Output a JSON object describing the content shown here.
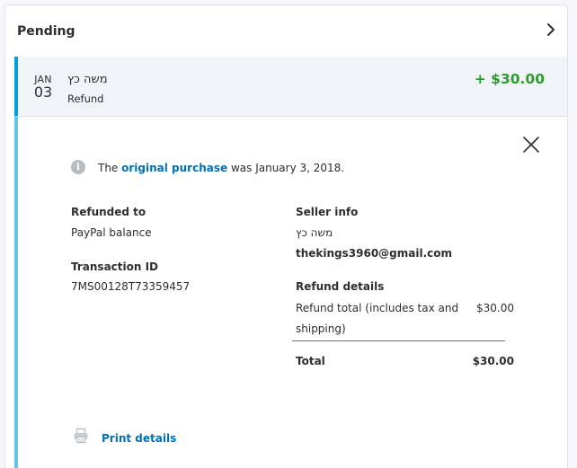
{
  "header": {
    "title": "Pending"
  },
  "transaction": {
    "month": "JAN",
    "day": "03",
    "name": "משה כץ",
    "type": "Refund",
    "amount": "+ $30.00"
  },
  "info": {
    "prefix": "The ",
    "link_text": "original purchase",
    "suffix": " was January 3, 2018."
  },
  "refunded_to": {
    "label": "Refunded to",
    "value": "PayPal balance"
  },
  "transaction_id": {
    "label": "Transaction ID",
    "value": "7MS00128T73359457"
  },
  "seller_info": {
    "label": "Seller info",
    "name": "משה כץ",
    "email": "thekings3960@gmail.com"
  },
  "refund_details": {
    "label": "Refund details",
    "line_label_1": "Refund total (includes tax and",
    "line_label_2": "shipping)",
    "line_value": "$30.00",
    "total_label": "Total",
    "total_value": "$30.00"
  },
  "print": {
    "label": "Print details"
  },
  "colors": {
    "accent_blue": "#009cde",
    "link_blue": "#0070ba",
    "positive_green": "#2d9b2d",
    "row_background": "#f0f3f7"
  },
  "icons": [
    "chevron-right-icon",
    "close-icon",
    "info-icon",
    "printer-icon"
  ]
}
